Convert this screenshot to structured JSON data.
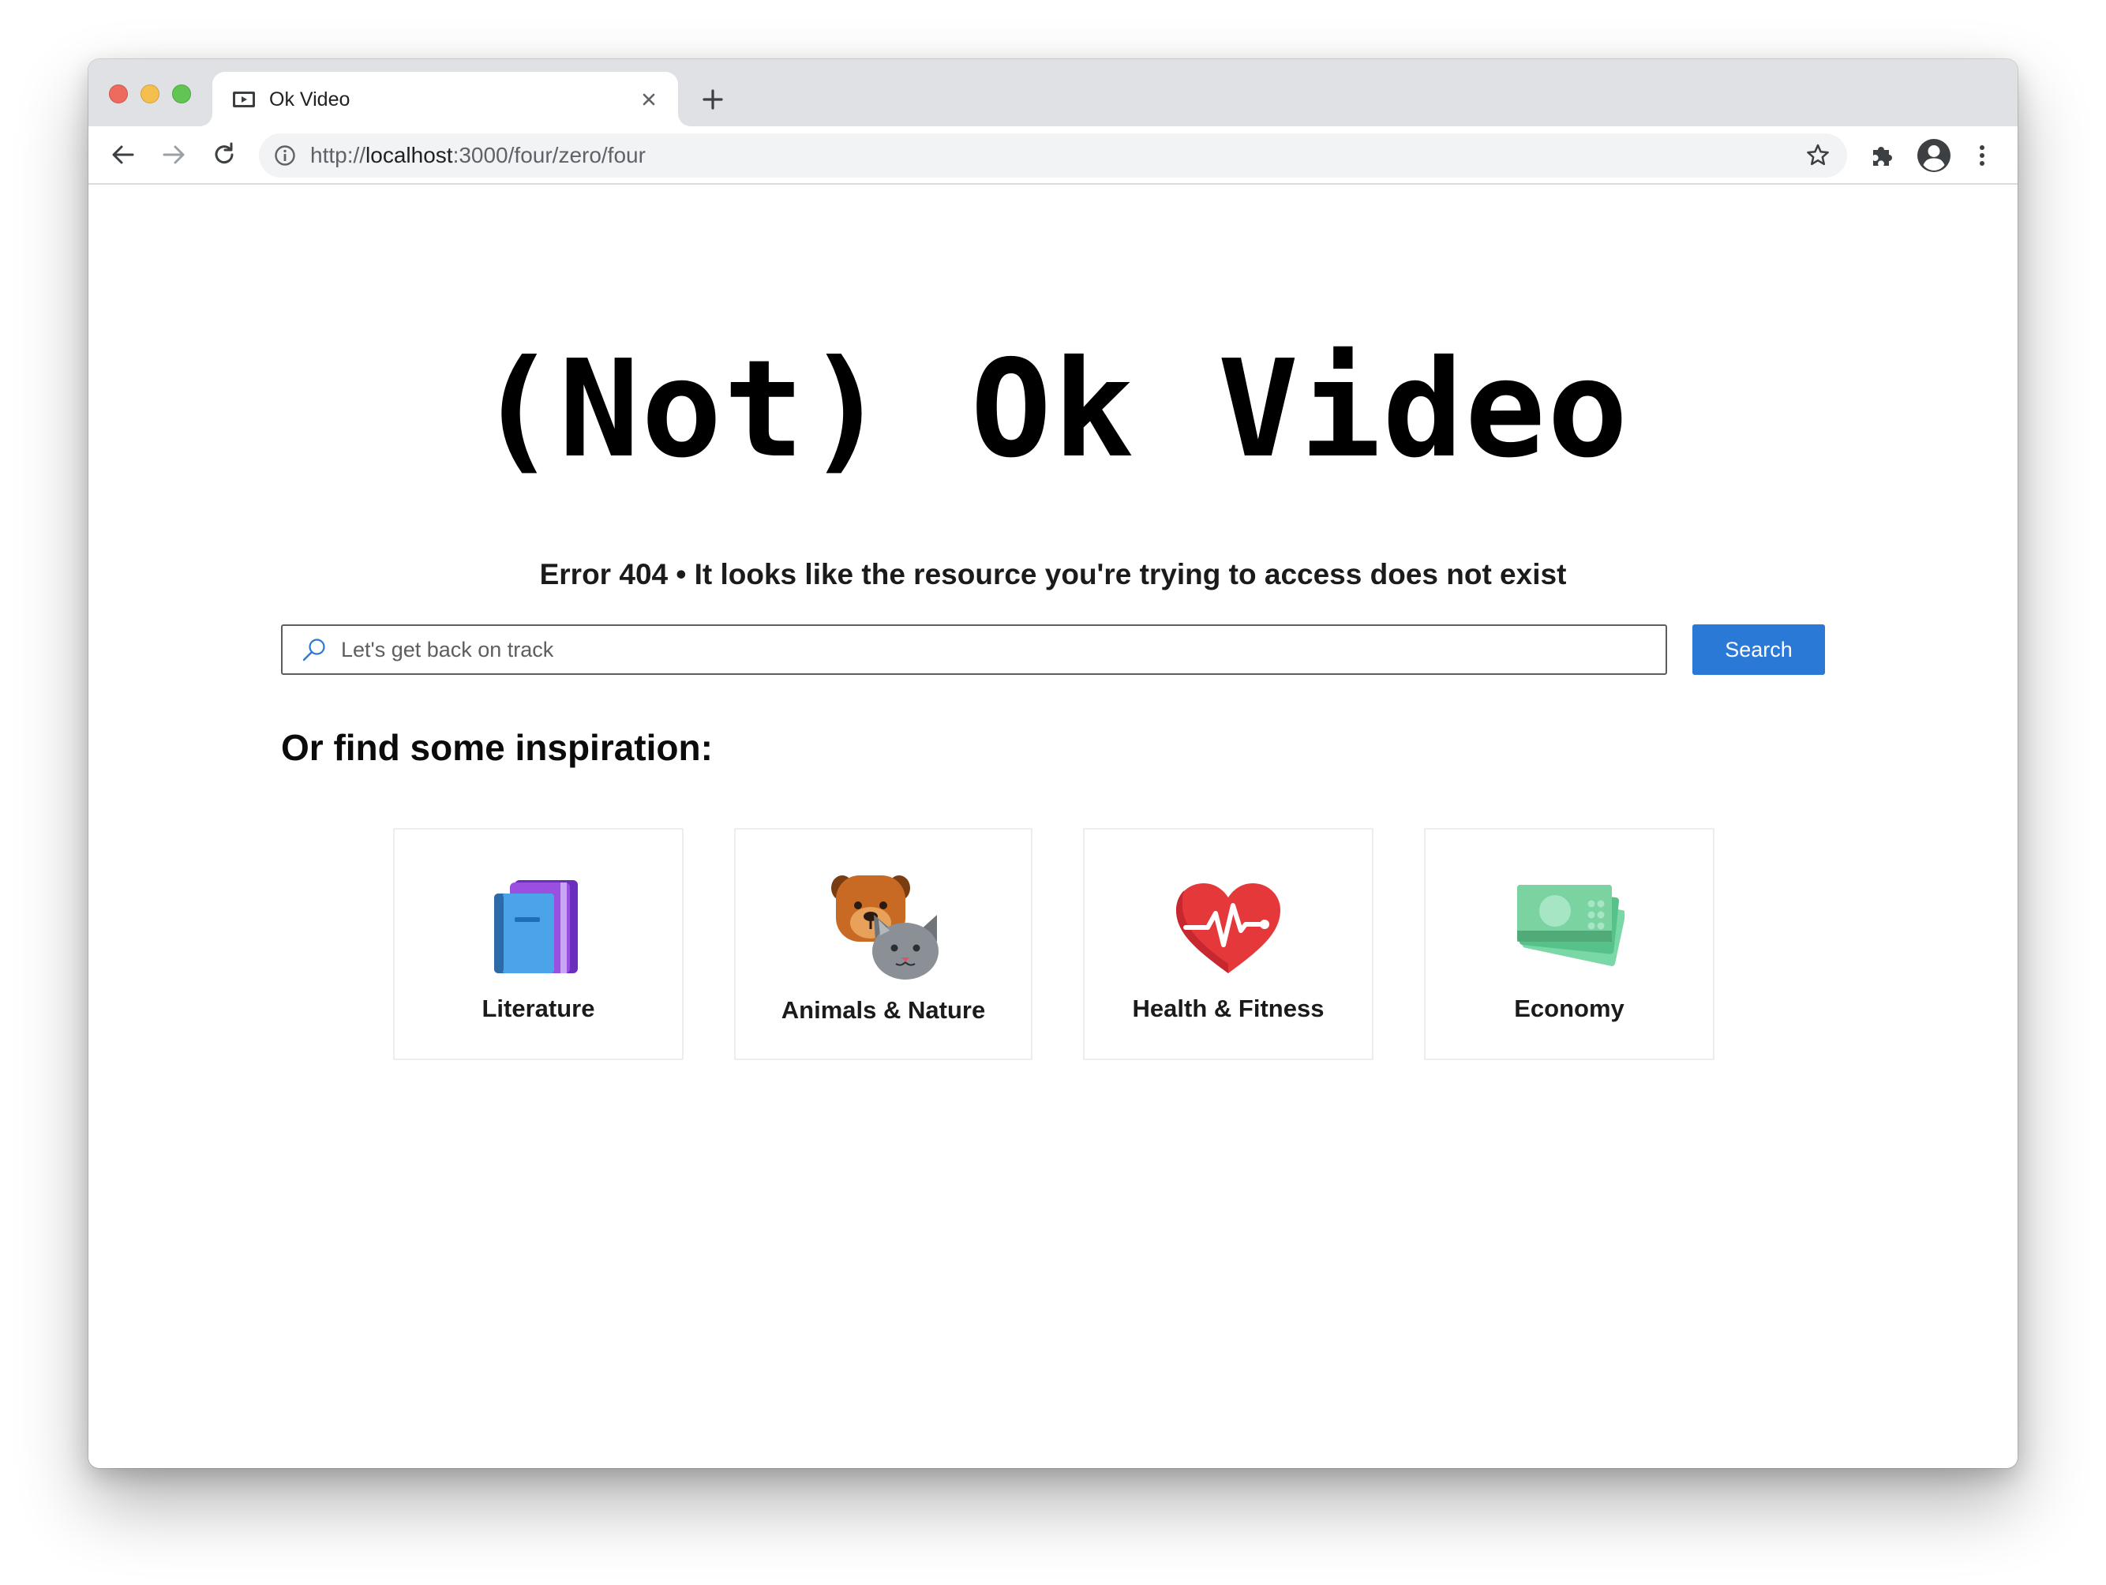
{
  "browser": {
    "tab_title": "Ok Video",
    "url_scheme": "http://",
    "url_host": "localhost",
    "url_rest": ":3000/four/zero/four"
  },
  "page": {
    "title": "(Not) Ok Video",
    "error_message": "Error 404 • It looks like the resource you're trying to access does not exist",
    "search": {
      "placeholder": "Let's get back on track",
      "value": "",
      "button_label": "Search"
    },
    "inspiration_heading": "Or find some inspiration:",
    "categories": [
      {
        "label": "Literature",
        "icon": "books-icon"
      },
      {
        "label": "Animals & Nature",
        "icon": "dog-cat-icon"
      },
      {
        "label": "Health & Fitness",
        "icon": "heartbeat-icon"
      },
      {
        "label": "Economy",
        "icon": "money-icon"
      }
    ]
  },
  "colors": {
    "accent": "#2b79d6",
    "tabstrip": "#dfe1e5"
  }
}
